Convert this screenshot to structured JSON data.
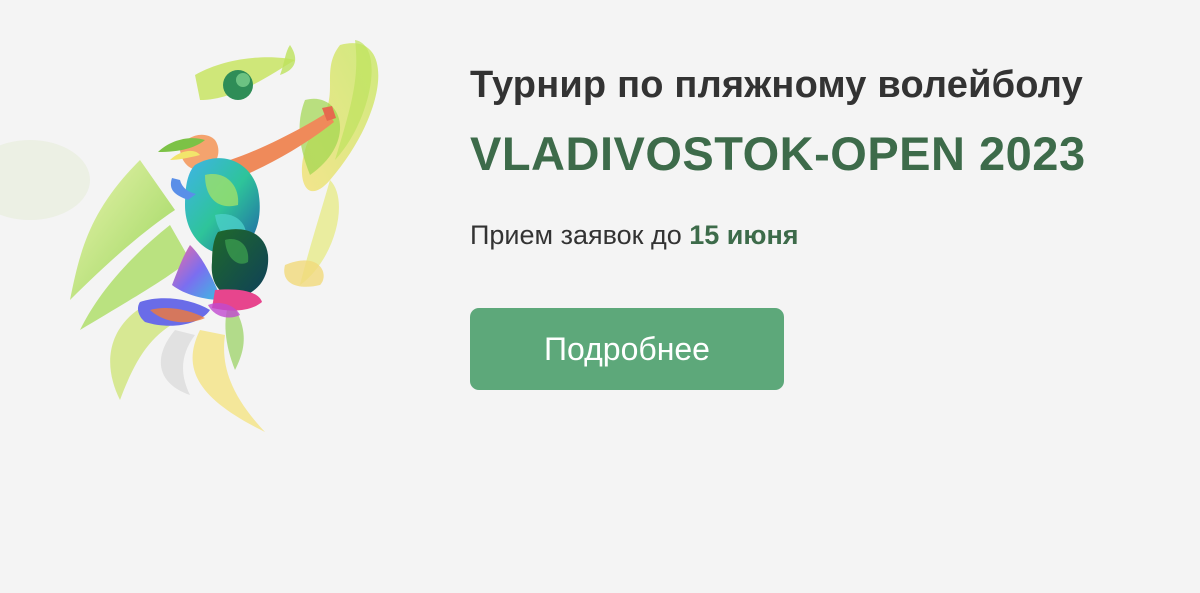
{
  "banner": {
    "subtitle": "Турнир по пляжному волейболу",
    "title": "VLADIVOSTOK-OPEN 2023",
    "deadline_prefix": "Прием заявок до",
    "deadline_date": "15 июня",
    "button_label": "Подробнее"
  },
  "colors": {
    "background": "#f4f4f4",
    "title_green": "#3d6b4a",
    "button_green": "#5da87a",
    "text_dark": "#333333"
  },
  "icons": {
    "illustration": "volleyball-player-illustration"
  }
}
